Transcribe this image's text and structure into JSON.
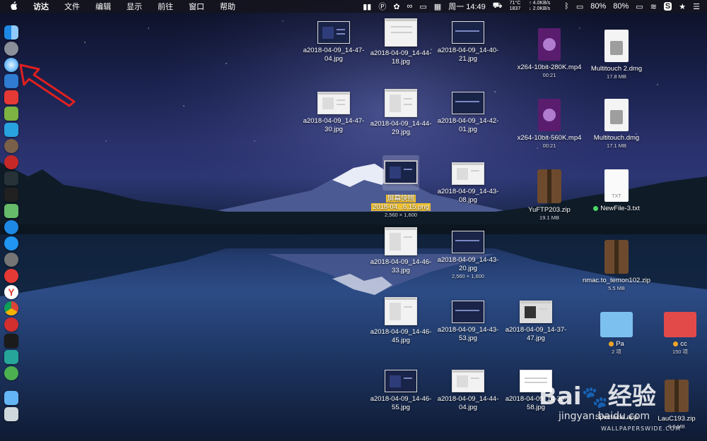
{
  "menubar": {
    "apple": "",
    "items": [
      "访达",
      "文件",
      "编辑",
      "显示",
      "前往",
      "窗口",
      "帮助"
    ],
    "clock": "周一 14:49",
    "temp_cpu": "71°C",
    "fan": "1837",
    "net_up": "↑ 4.0KB/s",
    "net_down": "↓ 2.0KB/s",
    "battery1": "80%",
    "battery2": "80%"
  },
  "dock": {
    "icons": [
      "finder-icon",
      "launchpad-icon",
      "safari-icon",
      "preview-icon",
      "app-icon",
      "android-icon",
      "migration-icon",
      "photo-icon",
      "netease-icon",
      "activity-icon",
      "terminal-icon",
      "maps-icon",
      "siri-icon",
      "appstore-icon",
      "system-prefs-icon",
      "weibo-icon",
      "yandex-icon",
      "chrome-icon",
      "vivaldi-icon",
      "terminal2-icon",
      "sync-icon",
      "wechat-icon",
      "folder-icon",
      "trash-icon"
    ]
  },
  "desktop": {
    "items": [
      {
        "label": "a2018-04-09_14-47-04.jpg"
      },
      {
        "label": "a2018-04-09_14-44-18.jpg"
      },
      {
        "label": "a2018-04-09_14-40-21.jpg"
      },
      {
        "label": "a2018-04-09_14-47-30.jpg"
      },
      {
        "label": "a2018-04-09_14-44-29.jpg"
      },
      {
        "label": "a2018-04-09_14-42-01.jpg"
      },
      {
        "label": "屏幕快照",
        "label2": "2018-04...6.15.png",
        "sub": "2,560 × 1,600"
      },
      {
        "label": "a2018-04-09_14-43-08.jpg"
      },
      {
        "label": "a2018-04-09_14-46-33.jpg"
      },
      {
        "label": "a2018-04-09_14-43-20.jpg",
        "sub": "2,560 × 1,600"
      },
      {
        "label": "a2018-04-09_14-46-45.jpg"
      },
      {
        "label": "a2018-04-09_14-43-53.jpg"
      },
      {
        "label": "a2018-04-09_14-37-47.jpg"
      },
      {
        "label": "a2018-04-09_14-46-55.jpg"
      },
      {
        "label": "a2018-04-09_14-44-04.jpg"
      },
      {
        "label": "a2018-04-09_14-39-58.jpg"
      },
      {
        "label": "x264-10bit-280K.mp4",
        "sub": "00:21"
      },
      {
        "label": "x264-10bit-560K.mp4",
        "sub": "00:21"
      },
      {
        "label": "YuFTP203.zip",
        "sub": "19.1 MB"
      },
      {
        "label": "Multitouch 2.dmg",
        "sub": "17.8 MB"
      },
      {
        "label": "Multitouch.dmg",
        "sub": "17.1 MB"
      },
      {
        "label": "NewFile-3.txt",
        "file_text": "TXT"
      },
      {
        "label": "nmac.to_temon102.zip",
        "sub": "5.5 MB"
      },
      {
        "label": "Pa",
        "sub": "2 项"
      },
      {
        "label": "cc",
        "sub": "150 项"
      },
      {
        "label": "Spectacle.app"
      },
      {
        "label": "LauC193.zip",
        "sub": "9.9 MB"
      }
    ]
  },
  "watermark": {
    "baidu": "Bai",
    "du": "经验",
    "url": "jingyan.baidu.com",
    "site": "WALLPAPERSWIDE.COM"
  },
  "colors": {
    "arrow": "#e02020",
    "selection": "#f1c232",
    "tag_orange": "#f5a623",
    "tag_green": "#4cd964",
    "folder_blue": "#7cc0f0",
    "folder_red": "#e24a4a"
  }
}
